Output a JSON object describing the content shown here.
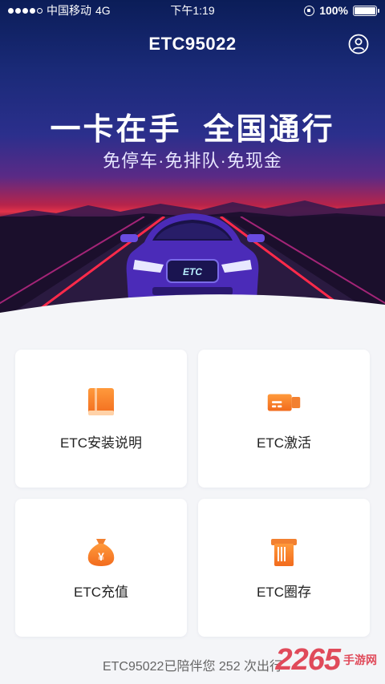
{
  "status_bar": {
    "carrier": "中国移动",
    "network": "4G",
    "time": "下午1:19",
    "battery": "100%",
    "battery_level": 1.0
  },
  "header": {
    "title": "ETC95022",
    "user_icon": "user-circle-icon"
  },
  "banner": {
    "headline": "一卡在手  全国通行",
    "subline": "免停车·免排队·免现金",
    "plate_text": "ETC"
  },
  "menu": [
    {
      "label": "ETC安装说明",
      "icon": "book-icon"
    },
    {
      "label": "ETC激活",
      "icon": "etc-card-icon"
    },
    {
      "label": "ETC充值",
      "icon": "money-bag-icon"
    },
    {
      "label": "ETC圈存",
      "icon": "card-slot-icon"
    }
  ],
  "footer": {
    "text": "ETC95022已陪伴您 252 次出行"
  },
  "watermark": {
    "number": "2265",
    "site": "手游网"
  },
  "colors": {
    "accent": "#f26b1d",
    "accent_light": "#ff9a3c"
  }
}
